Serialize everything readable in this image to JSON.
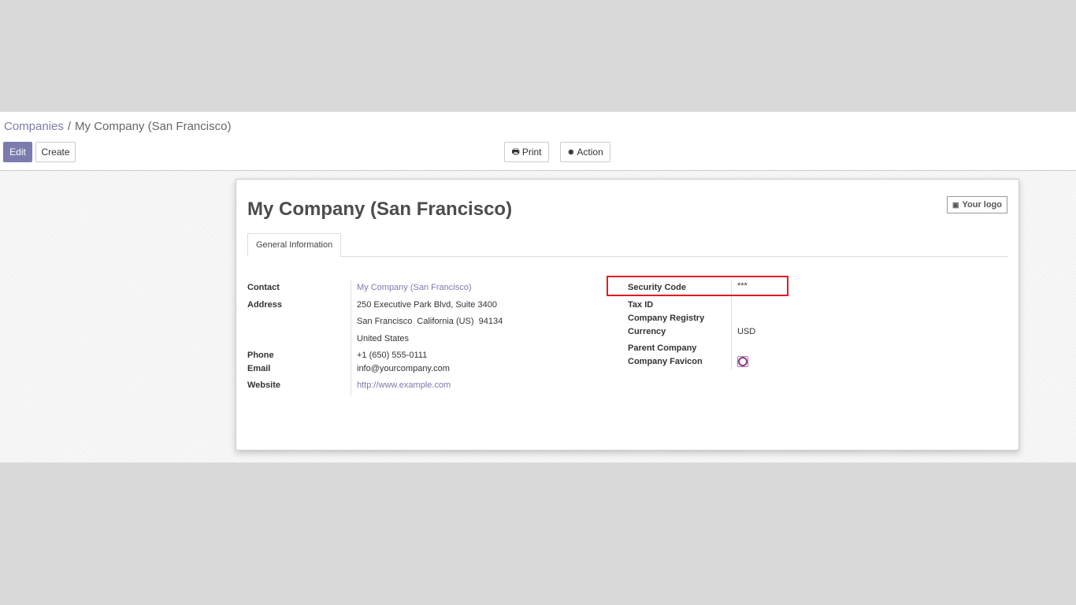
{
  "breadcrumb": {
    "parent": "Companies",
    "separator": "/",
    "current": "My Company (San Francisco)"
  },
  "toolbar": {
    "edit_label": "Edit",
    "create_label": "Create",
    "print_label": "Print",
    "action_label": "Action"
  },
  "record": {
    "title": "My Company (San Francisco)",
    "logo_button": "Your logo",
    "tab_general": "General Information",
    "left": {
      "contact_label": "Contact",
      "contact_value": "My Company (San Francisco)",
      "address_label": "Address",
      "address_line1": "250 Executive Park Blvd, Suite 3400",
      "address_line2": "San Francisco  California (US)  94134",
      "address_line3": "United States",
      "phone_label": "Phone",
      "phone_value": "+1 (650) 555-0111",
      "email_label": "Email",
      "email_value": "info@yourcompany.com",
      "website_label": "Website",
      "website_value": "http://www.example.com"
    },
    "right": {
      "security_code_label": "Security Code",
      "security_code_value": "***",
      "tax_id_label": "Tax ID",
      "company_registry_label": "Company Registry",
      "currency_label": "Currency",
      "currency_value": "USD",
      "parent_company_label": "Parent Company",
      "favicon_label": "Company Favicon"
    }
  },
  "icons": {
    "print": "printer-icon",
    "action": "gear-icon",
    "logo": "camera-icon",
    "favicon": "odoo-favicon-icon"
  },
  "colors": {
    "primary": "#7c7bad",
    "highlight": "#e31b23"
  }
}
